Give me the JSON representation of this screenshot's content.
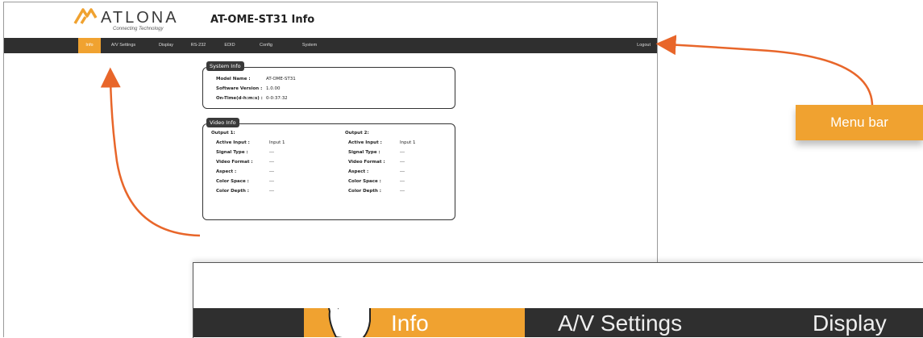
{
  "logo": {
    "wordmark": "ATLONA",
    "tagline": "Connecting Technology"
  },
  "page_title": "AT-OME-ST31  Info",
  "menu": {
    "items": [
      "Info",
      "A/V Settings",
      "Display",
      "RS-232",
      "EDID",
      "Config",
      "System"
    ],
    "active": "Info",
    "logout": "Logout"
  },
  "system_info": {
    "title": "System Info",
    "rows": [
      {
        "key": "Model Name :",
        "value": "AT-OME-ST31"
      },
      {
        "key": "Software Version :",
        "value": "1.0.00"
      },
      {
        "key": "On-Time(d-h:m:s) :",
        "value": "0-0:37:32"
      }
    ]
  },
  "video_info": {
    "title": "Video Info",
    "outputs": [
      {
        "label": "Output 1:",
        "rows": [
          {
            "key": "Active Input :",
            "value": "Input 1"
          },
          {
            "key": "Signal Type :",
            "value": "---"
          },
          {
            "key": "Video Format :",
            "value": "---"
          },
          {
            "key": "Aspect :",
            "value": "---"
          },
          {
            "key": "Color Space :",
            "value": "---"
          },
          {
            "key": "Color Depth :",
            "value": "---"
          }
        ]
      },
      {
        "label": "Output 2:",
        "rows": [
          {
            "key": "Active Input :",
            "value": "Input 1"
          },
          {
            "key": "Signal Type :",
            "value": "---"
          },
          {
            "key": "Video Format :",
            "value": "---"
          },
          {
            "key": "Aspect :",
            "value": "---"
          },
          {
            "key": "Color Space :",
            "value": "---"
          },
          {
            "key": "Color Depth :",
            "value": "---"
          }
        ]
      }
    ]
  },
  "zoom_menu": {
    "items": [
      "Info",
      "A/V Settings",
      "Display"
    ]
  },
  "callout": {
    "label": "Menu bar"
  },
  "colors": {
    "accent": "#f0a230",
    "menubar": "#2f2f2f",
    "arrow": "#e8662a"
  }
}
